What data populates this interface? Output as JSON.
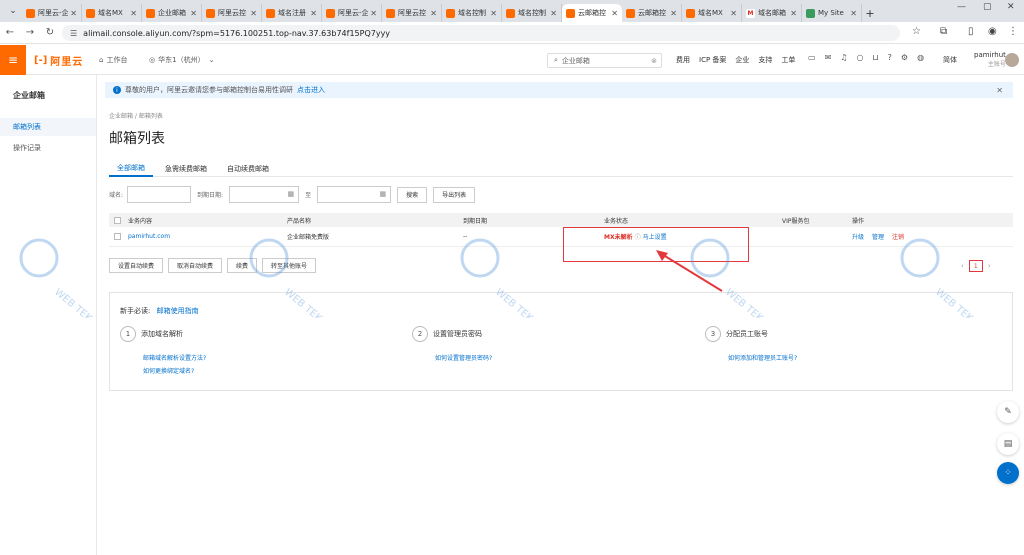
{
  "browser": {
    "tabs": [
      {
        "title": "阿里云-企",
        "icon": "aliyun"
      },
      {
        "title": "域名MX",
        "icon": "aliyun"
      },
      {
        "title": "企业邮箱",
        "icon": "aliyun"
      },
      {
        "title": "阿里云控",
        "icon": "aliyun"
      },
      {
        "title": "域名注册",
        "icon": "aliyun"
      },
      {
        "title": "阿里云-企",
        "icon": "aliyun"
      },
      {
        "title": "阿里云控",
        "icon": "aliyun"
      },
      {
        "title": "域名控制",
        "icon": "aliyun"
      },
      {
        "title": "域名控制",
        "icon": "aliyun"
      },
      {
        "title": "云邮箱控",
        "icon": "aliyun",
        "active": true
      },
      {
        "title": "云邮箱控",
        "icon": "aliyun"
      },
      {
        "title": "域名MX",
        "icon": "aliyun"
      },
      {
        "title": "域名邮箱",
        "icon": "gmail"
      },
      {
        "title": "My Site",
        "icon": "site"
      }
    ],
    "url": "alimail.console.aliyun.com/?spm=5176.100251.top-nav.37.63b74f15PQ7yyy"
  },
  "topnav": {
    "logo_text": "阿里云",
    "workbench": "工作台",
    "region": "华东1（杭州）",
    "search_placeholder": "企业邮箱",
    "links": [
      "费用",
      "ICP 备案",
      "企业",
      "支持",
      "工单"
    ],
    "lang": "简体",
    "user_name": "pamirhut",
    "user_role": "主账号"
  },
  "sidebar": {
    "title": "企业邮箱",
    "items": [
      {
        "label": "邮箱列表",
        "active": true
      },
      {
        "label": "操作记录",
        "active": false
      }
    ]
  },
  "notice": {
    "text": "尊敬的用户，阿里云邀请您参与邮箱控制台易用性调研",
    "link": "点击进入"
  },
  "breadcrumb": "企业邮箱 / 邮箱列表",
  "page_title": "邮箱列表",
  "tabs": [
    "全部邮箱",
    "急需续费邮箱",
    "自动续费邮箱"
  ],
  "filters": {
    "domain_label": "域名:",
    "date_label": "到期日期:",
    "to_label": "至",
    "search_btn": "搜索",
    "export_btn": "导出列表"
  },
  "table": {
    "headers": [
      "业务内容",
      "产品名称",
      "到期日期",
      "业务状态",
      "VIP服务包",
      "操作"
    ],
    "row": {
      "domain": "pamirhut.com",
      "product": "企业邮箱免费版",
      "expiry": "--",
      "status": "MX未解析",
      "status_link": "马上设置",
      "vip": "",
      "ops": [
        "升级",
        "管理",
        "注销"
      ]
    }
  },
  "actions": [
    "设置自动续费",
    "取消自动续费",
    "续费",
    "转至其他账号"
  ],
  "pager": {
    "page": "1"
  },
  "guide": {
    "title": "新手必读:",
    "title_link": "邮箱使用指南",
    "steps": [
      {
        "num": "1",
        "label": "添加域名解析",
        "links": [
          "邮箱域名解析设置方法?",
          "如何更换绑定域名?"
        ]
      },
      {
        "num": "2",
        "label": "设置管理员密码",
        "links": [
          "如何设置管理员密码?"
        ]
      },
      {
        "num": "3",
        "label": "分配员工账号",
        "links": [
          "如何添加和管理员工账号?"
        ]
      }
    ]
  },
  "watermark": "WEB TEK",
  "colors": {
    "brand": "#ff6a00",
    "link": "#0070cc",
    "alert": "#d93025"
  }
}
